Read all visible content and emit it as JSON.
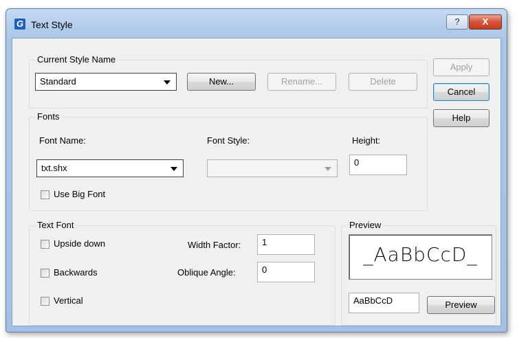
{
  "window": {
    "title": "Text Style",
    "app_icon": "G",
    "help_glyph": "?",
    "close_glyph": "X"
  },
  "current_style": {
    "group_label": "Current Style Name",
    "selected": "Standard",
    "new_label": "New...",
    "rename_label": "Rename...",
    "delete_label": "Delete"
  },
  "side_buttons": {
    "apply": "Apply",
    "cancel": "Cancel",
    "help": "Help"
  },
  "fonts": {
    "group_label": "Fonts",
    "font_name_label": "Font Name:",
    "font_name_value": "txt.shx",
    "font_style_label": "Font Style:",
    "font_style_value": "",
    "height_label": "Height:",
    "height_value": "0",
    "big_font_label": "Use Big Font"
  },
  "text_font": {
    "group_label": "Text Font",
    "upside_down": "Upside down",
    "backwards": "Backwards",
    "vertical": "Vertical",
    "width_factor_label": "Width Factor:",
    "width_factor_value": "1",
    "oblique_label": "Oblique Angle:",
    "oblique_value": "0"
  },
  "preview": {
    "group_label": "Preview",
    "display_text": "_AaBbCcD_",
    "input_value": "AaBbCcD",
    "button_label": "Preview"
  }
}
